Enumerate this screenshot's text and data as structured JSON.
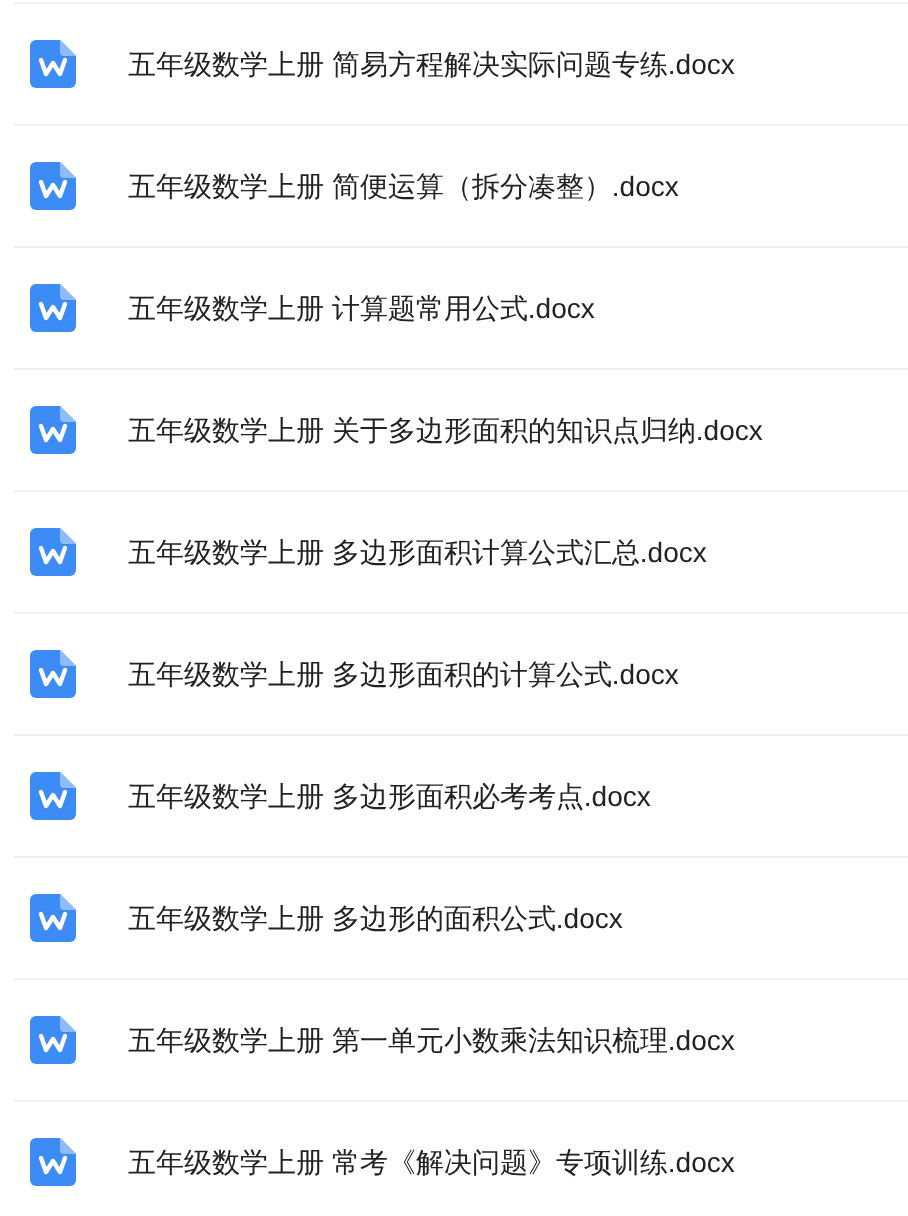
{
  "files": [
    {
      "name": "五年级数学上册 简易方程解决实际问题专练.docx",
      "kind": "word"
    },
    {
      "name": "五年级数学上册 简便运算（拆分凑整）.docx",
      "kind": "word"
    },
    {
      "name": "五年级数学上册 计算题常用公式.docx",
      "kind": "word"
    },
    {
      "name": "五年级数学上册 关于多边形面积的知识点归纳.docx",
      "kind": "word"
    },
    {
      "name": "五年级数学上册 多边形面积计算公式汇总.docx",
      "kind": "word"
    },
    {
      "name": "五年级数学上册 多边形面积的计算公式.docx",
      "kind": "word"
    },
    {
      "name": "五年级数学上册 多边形面积必考考点.docx",
      "kind": "word"
    },
    {
      "name": "五年级数学上册 多边形的面积公式.docx",
      "kind": "word"
    },
    {
      "name": "五年级数学上册 第一单元小数乘法知识梳理.docx",
      "kind": "word"
    },
    {
      "name": "五年级数学上册 常考《解决问题》专项训练.docx",
      "kind": "word"
    }
  ]
}
